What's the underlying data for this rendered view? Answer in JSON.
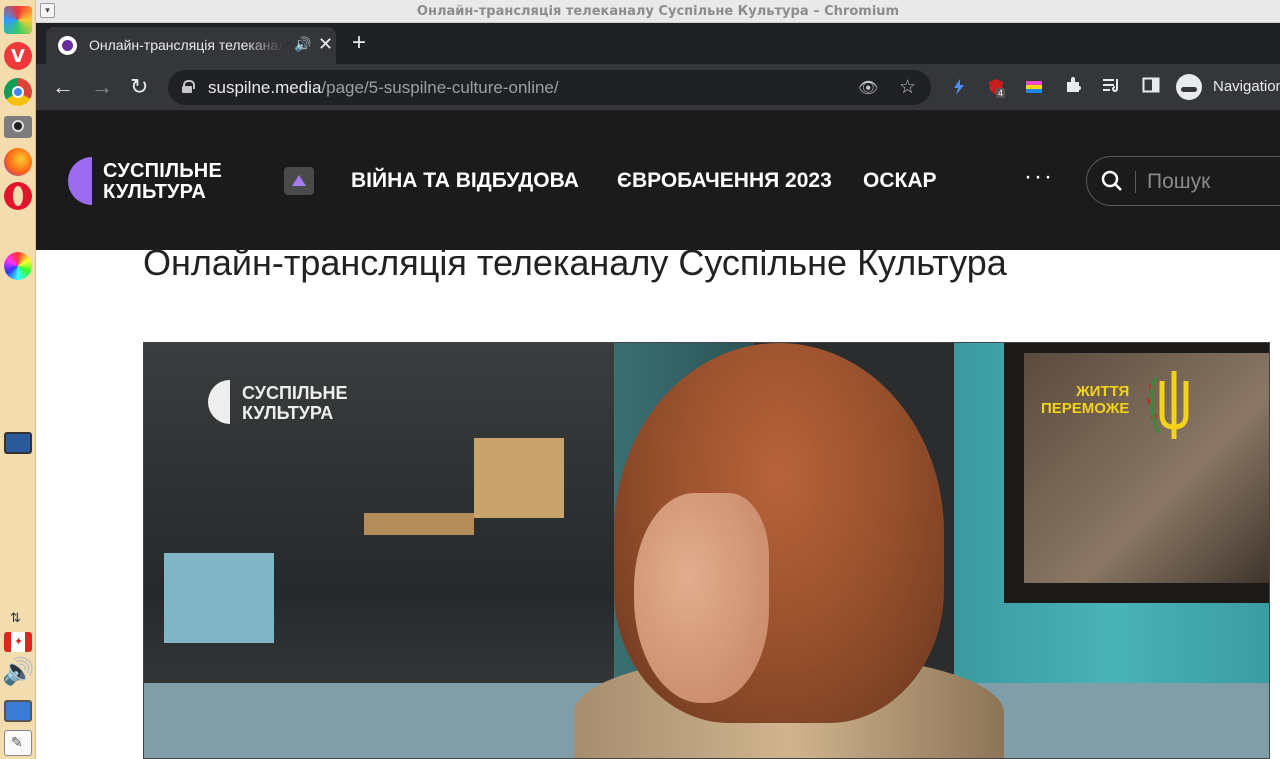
{
  "window": {
    "title": "Онлайн-трансляція телеканалу Суспільне Культура – Chromium",
    "menu_button": "▾"
  },
  "dock": {
    "icons": [
      "paint-icon",
      "vivaldi-icon",
      "chrome-icon",
      "camera-icon",
      "firefox-icon",
      "opera-icon",
      "color-wheel-icon",
      "monitor-icon",
      "network-icon",
      "canada-flag-icon",
      "volume-icon",
      "display-icon",
      "text-editor-icon"
    ]
  },
  "tab": {
    "title": "Онлайн-трансляція телеканалу Суспільне Культура",
    "audio_icon": "🔊",
    "close_icon": "✕",
    "new_tab_icon": "+"
  },
  "toolbar": {
    "back_icon": "←",
    "forward_icon": "→",
    "reload_icon": "↻",
    "url_host": "suspilne.media",
    "url_path": "/page/5-suspilne-culture-online/",
    "tracking_icon": "👁",
    "star_icon": "☆",
    "extension_badge": "4",
    "navigation_label": "Navigation"
  },
  "site": {
    "logo_line1": "СУСПІЛЬНЕ",
    "logo_line2": "КУЛЬТУРА",
    "nav": [
      "ВІЙНА ТА ВІДБУДОВА",
      "ЄВРОБАЧЕННЯ 2023",
      "ОСКАР"
    ],
    "more": "···",
    "search_placeholder": "Пошук",
    "brand_color": "#9b6bf0"
  },
  "page": {
    "title": "Онлайн-трансляція телеканалу Суспільне Культура"
  },
  "video": {
    "logo_line1": "СУСПІЛЬНЕ",
    "logo_line2": "КУЛЬТУРА",
    "slogan_line1": "ЖИТТЯ",
    "slogan_line2": "ПЕРЕМОЖЕ",
    "slogan_color": "#f3d21c"
  }
}
